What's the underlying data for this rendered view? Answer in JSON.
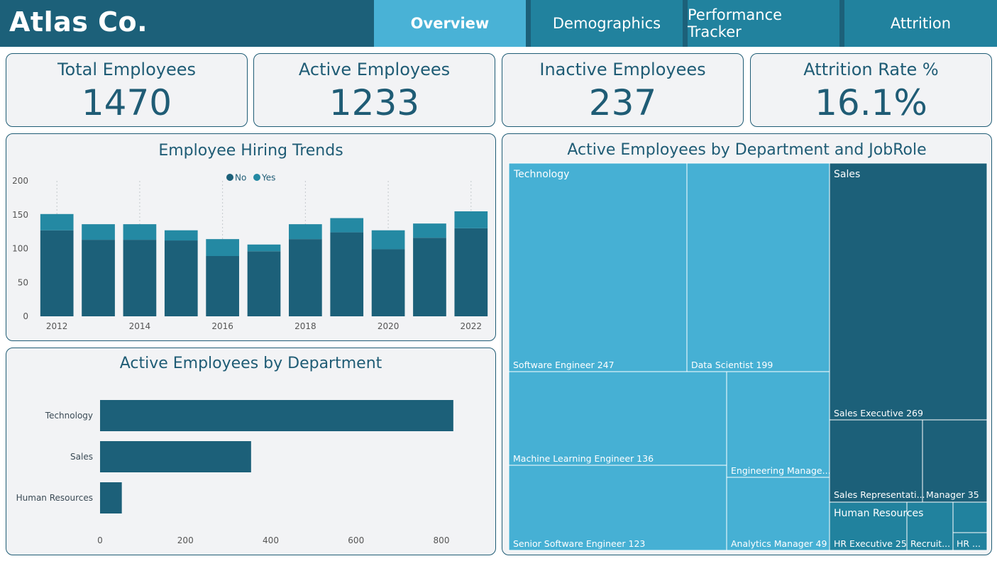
{
  "header": {
    "brand": "Atlas Co.",
    "tabs": [
      {
        "label": "Overview",
        "active": true
      },
      {
        "label": "Demographics",
        "active": false
      },
      {
        "label": "Performance Tracker",
        "active": false
      },
      {
        "label": "Attrition",
        "active": false
      }
    ]
  },
  "kpis": [
    {
      "label": "Total Employees",
      "value": "1470"
    },
    {
      "label": "Active Employees",
      "value": "1233"
    },
    {
      "label": "Inactive Employees",
      "value": "237"
    },
    {
      "label": "Attrition Rate %",
      "value": "16.1%"
    }
  ],
  "colors": {
    "header": "#1c6079",
    "tab": "#21829e",
    "tab_active": "#49b2d6",
    "series_no": "#1c6079",
    "series_yes": "#2489a3",
    "treemap_technology": "#46b0d4",
    "treemap_sales": "#1c6079",
    "treemap_hr": "#21829e"
  },
  "hiring": {
    "title": "Employee Hiring Trends",
    "legend": [
      "No",
      "Yes"
    ]
  },
  "dept_bar": {
    "title": "Active Employees by Department"
  },
  "treemap": {
    "title": "Active Employees by Department and JobRole",
    "departments": [
      {
        "name": "Technology",
        "roles": [
          {
            "label": "Software Engineer 247"
          },
          {
            "label": "Data Scientist 199"
          },
          {
            "label": "Machine Learning Engineer 136"
          },
          {
            "label": "Senior Software Engineer 123"
          },
          {
            "label": "Engineering Manage..."
          },
          {
            "label": "Analytics Manager 49"
          }
        ]
      },
      {
        "name": "Sales",
        "roles": [
          {
            "label": "Sales Executive 269"
          },
          {
            "label": "Sales Representati..."
          },
          {
            "label": "Manager 35"
          }
        ]
      },
      {
        "name": "Human Resources",
        "roles": [
          {
            "label": "HR Executive 25"
          },
          {
            "label": "Recruit..."
          },
          {
            "label": "HR ..."
          }
        ]
      }
    ]
  },
  "chart_data": [
    {
      "type": "bar",
      "stacked": true,
      "title": "Employee Hiring Trends",
      "categories": [
        2012,
        2013,
        2014,
        2015,
        2016,
        2017,
        2018,
        2019,
        2020,
        2021,
        2022
      ],
      "x_tick_labels": [
        "2012",
        "2014",
        "2016",
        "2018",
        "2020",
        "2022"
      ],
      "series": [
        {
          "name": "No",
          "values": [
            127,
            113,
            113,
            112,
            89,
            96,
            114,
            124,
            99,
            116,
            130
          ]
        },
        {
          "name": "Yes",
          "values": [
            24,
            23,
            23,
            15,
            25,
            10,
            22,
            21,
            28,
            21,
            25
          ]
        }
      ],
      "ylim": [
        0,
        200
      ],
      "y_ticks": [
        0,
        50,
        100,
        150,
        200
      ],
      "legend": "top-center",
      "grid": false
    },
    {
      "type": "bar",
      "orientation": "horizontal",
      "title": "Active Employees by Department",
      "categories": [
        "Technology",
        "Sales",
        "Human Resources"
      ],
      "values": [
        828,
        354,
        51
      ],
      "xlim": [
        0,
        850
      ],
      "x_ticks": [
        0,
        200,
        400,
        600,
        800
      ],
      "grid": false
    }
  ]
}
